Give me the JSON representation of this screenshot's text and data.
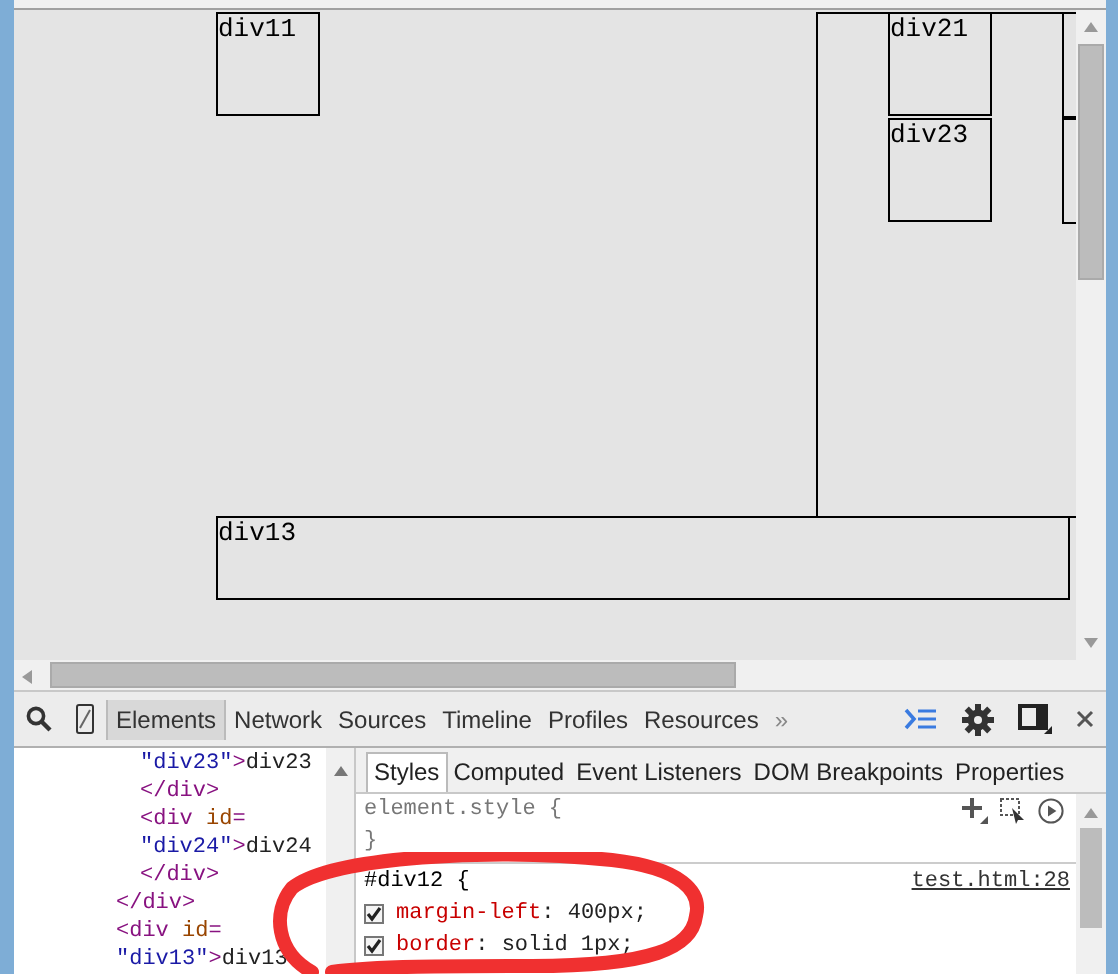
{
  "page_boxes": [
    {
      "label": "div11"
    },
    {
      "label": "div21"
    },
    {
      "label": "div23"
    },
    {
      "label": "div13"
    }
  ],
  "devtools": {
    "tabs": [
      {
        "label": "Elements",
        "selected": true
      },
      {
        "label": "Network",
        "selected": false
      },
      {
        "label": "Sources",
        "selected": false
      },
      {
        "label": "Timeline",
        "selected": false
      },
      {
        "label": "Profiles",
        "selected": false
      },
      {
        "label": "Resources",
        "selected": false
      }
    ],
    "more_tabs": "»",
    "elements_tree": [
      {
        "children": [
          {
            "segments": [
              {
                "kind": "value",
                "text": "\"div23\""
              },
              {
                "kind": "tag",
                "text": ">"
              },
              {
                "kind": "text",
                "text": "div23"
              }
            ]
          },
          {
            "segments": [
              {
                "kind": "tag",
                "text": "</div>"
              }
            ]
          },
          {
            "segments": [
              {
                "kind": "tag",
                "text": "<div"
              },
              {
                "kind": "attr",
                "text": " id"
              },
              {
                "kind": "tag",
                "text": "="
              }
            ]
          },
          {
            "segments": [
              {
                "kind": "value",
                "text": "\"div24\""
              },
              {
                "kind": "tag",
                "text": ">"
              },
              {
                "kind": "text",
                "text": "div24"
              }
            ]
          },
          {
            "segments": [
              {
                "kind": "tag",
                "text": "</div>"
              }
            ]
          }
        ]
      },
      {
        "segments": [
          {
            "kind": "tag",
            "text": "</div>"
          }
        ]
      },
      {
        "segments": [
          {
            "kind": "tag",
            "text": "<div"
          },
          {
            "kind": "attr",
            "text": " id"
          },
          {
            "kind": "tag",
            "text": "="
          }
        ]
      },
      {
        "segments": [
          {
            "kind": "value",
            "text": "\"div13\""
          },
          {
            "kind": "tag",
            "text": ">"
          },
          {
            "kind": "text",
            "text": "div13"
          }
        ]
      }
    ],
    "styles_tabs": [
      {
        "label": "Styles",
        "selected": true
      },
      {
        "label": "Computed",
        "selected": false
      },
      {
        "label": "Event Listeners",
        "selected": false
      },
      {
        "label": "DOM Breakpoints",
        "selected": false
      },
      {
        "label": "Properties",
        "selected": false
      }
    ],
    "element_style": {
      "open": "element.style {",
      "close": "}"
    },
    "rule": {
      "selector": "#div12 {",
      "source": "test.html:28",
      "separator": ":",
      "properties": [
        {
          "name": "margin-left",
          "value": "400px;",
          "checked": true
        },
        {
          "name": "border",
          "value": "solid 1px;",
          "checked": true
        }
      ]
    }
  }
}
